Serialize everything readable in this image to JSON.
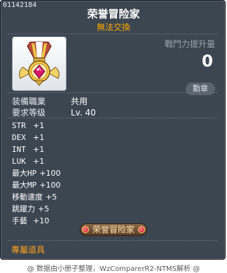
{
  "item": {
    "id": "01142184",
    "name": "荣誉冒险家",
    "trade_flag": "無法交換",
    "icon": "medal-icon"
  },
  "power": {
    "label": "戰鬥力提升量",
    "value": "0",
    "compare_label": "勳章"
  },
  "requirements": [
    {
      "label": "装備職業",
      "value": "共用"
    },
    {
      "label": "要求等级",
      "value": "Lv. 40"
    }
  ],
  "stats": [
    {
      "label": "STR",
      "value": "+1"
    },
    {
      "label": "DEX",
      "value": "+1"
    },
    {
      "label": "INT",
      "value": "+1"
    },
    {
      "label": "LUK",
      "value": "+1"
    },
    {
      "label": "最大HP",
      "value": "+100"
    },
    {
      "label": "最大MP",
      "value": "+100"
    },
    {
      "label": "移動速度",
      "value": "+5"
    },
    {
      "label": "跳躍力",
      "value": "+5"
    },
    {
      "label": "手藝",
      "value": "+10"
    }
  ],
  "medal_tag": "荣誉冒险家",
  "exclusive_label": "專屬道具",
  "footer": "@ 数据由小册子整理，WzComparerR2-NTMS解析 @",
  "colors": {
    "panel_bg": "#3c4651",
    "trade_flag": "#ffaa00",
    "exclusive": "#ff9f1c"
  }
}
